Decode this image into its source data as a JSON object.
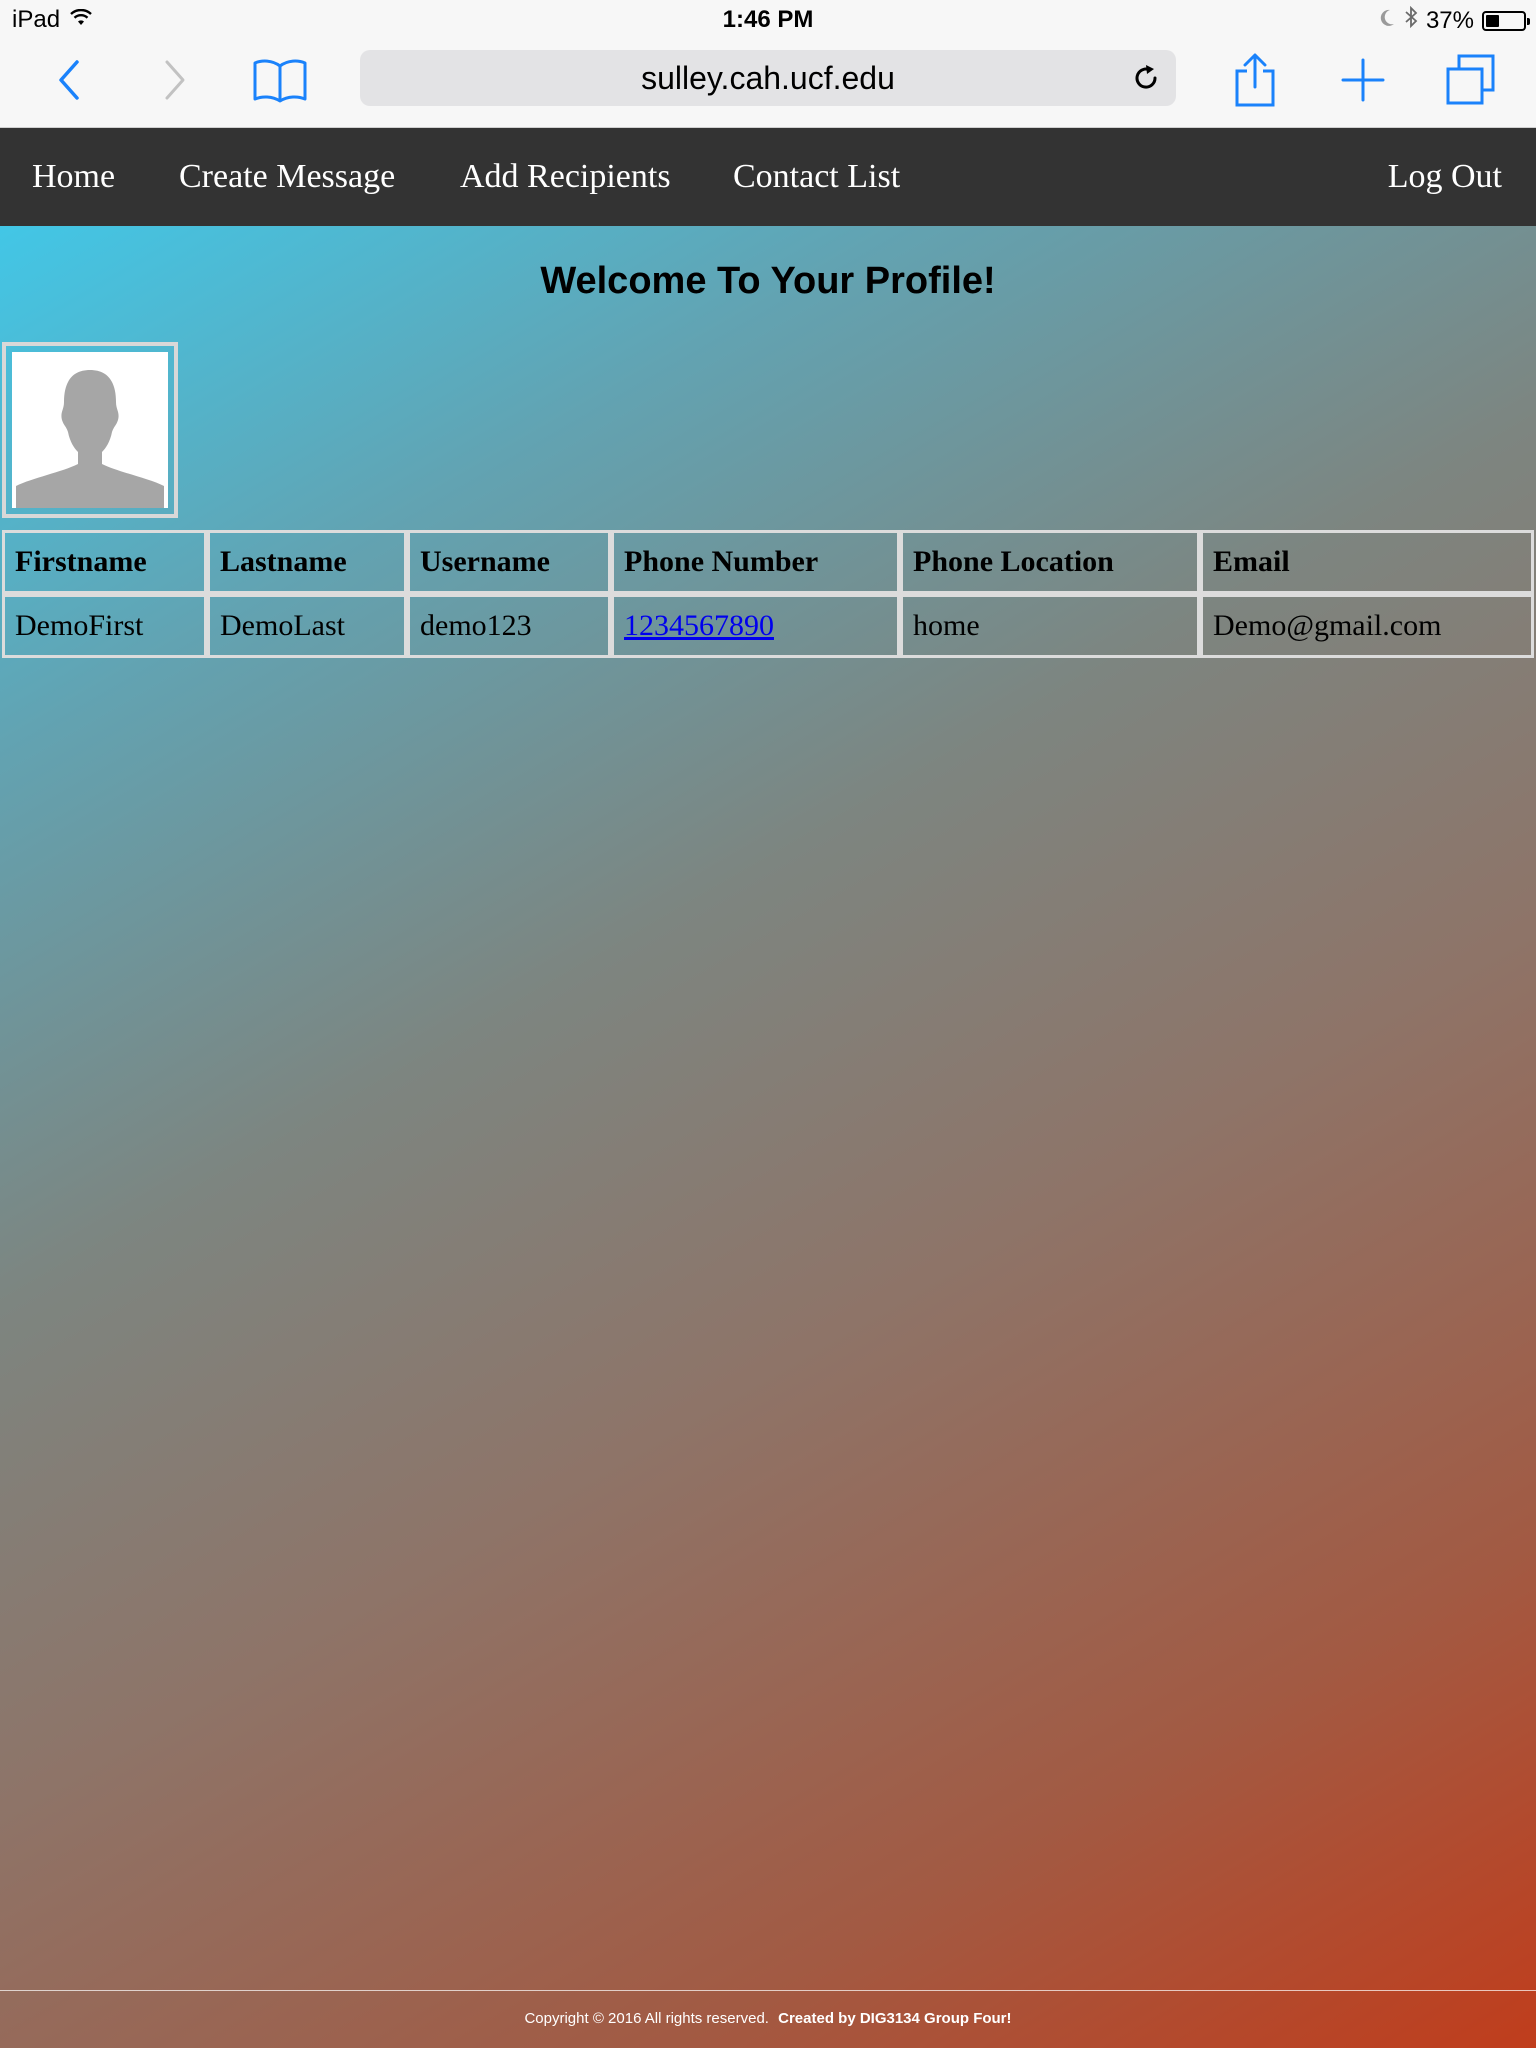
{
  "status_bar": {
    "device": "iPad",
    "time": "1:46 PM",
    "battery": "37%",
    "battery_level": 0.37
  },
  "browser": {
    "url": "sulley.cah.ucf.edu"
  },
  "nav": {
    "items": [
      "Home",
      "Create Message",
      "Add Recipients",
      "Contact List"
    ],
    "logout": "Log Out"
  },
  "page": {
    "title": "Welcome To Your Profile!"
  },
  "table": {
    "headers": [
      "Firstname",
      "Lastname",
      "Username",
      "Phone Number",
      "Phone Location",
      "Email"
    ],
    "row": {
      "firstname": "DemoFirst",
      "lastname": "DemoLast",
      "username": "demo123",
      "phone": "1234567890",
      "location": "home",
      "email": "Demo@gmail.com"
    }
  },
  "footer": {
    "copyright": "Copyright © 2016 All rights reserved.",
    "credit": "Created by DIG3134 Group Four!"
  },
  "colors": {
    "nav_bg": "#333333",
    "ios_blue": "#1a82fb",
    "link": "#0000ee"
  }
}
